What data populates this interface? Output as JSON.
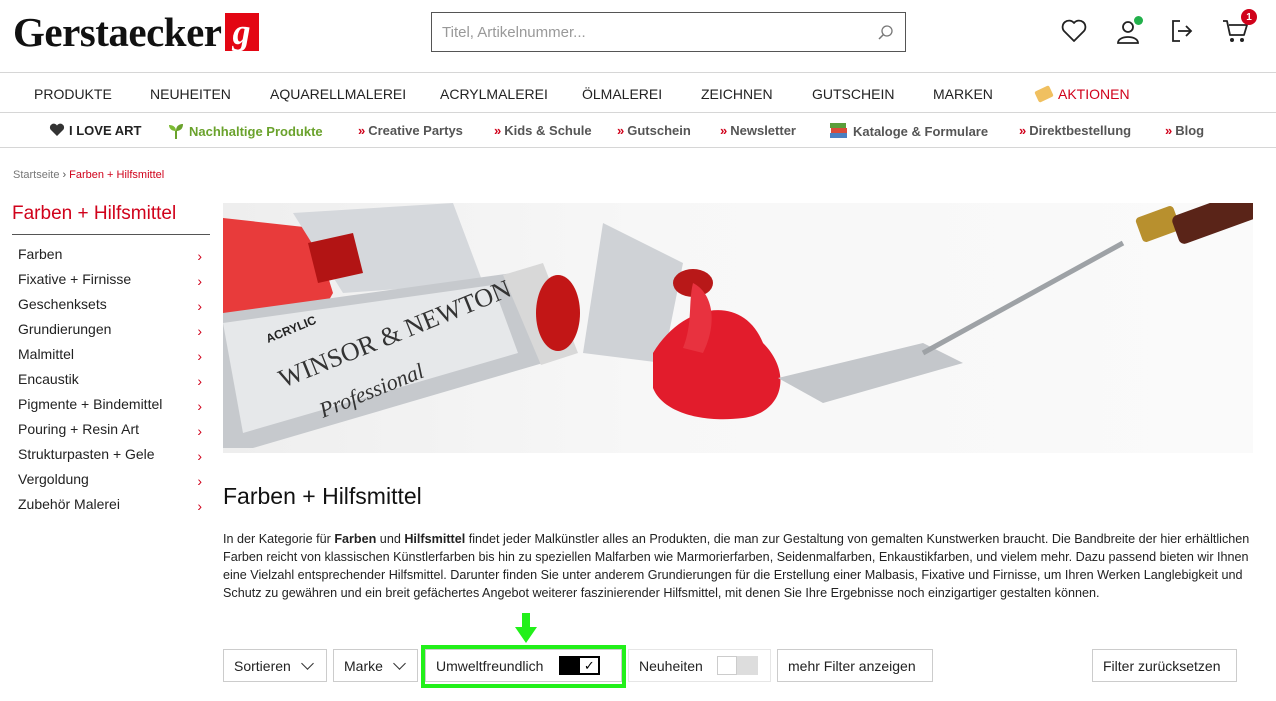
{
  "header": {
    "logo_text": "Gerstaecker",
    "logo_mark": "g",
    "search_placeholder": "Titel, Artikelnummer...",
    "cart_count": "1"
  },
  "main_nav": [
    {
      "label": "PRODUKTE"
    },
    {
      "label": "NEUHEITEN"
    },
    {
      "label": "AQUARELLMALEREI"
    },
    {
      "label": "ACRYLMALEREI"
    },
    {
      "label": "ÖLMALEREI"
    },
    {
      "label": "ZEICHNEN"
    },
    {
      "label": "GUTSCHEIN"
    },
    {
      "label": "MARKEN"
    },
    {
      "label": "AKTIONEN"
    }
  ],
  "sub_nav": [
    {
      "label": "I LOVE ART"
    },
    {
      "label": "Nachhaltige Produkte"
    },
    {
      "label": "Creative Partys"
    },
    {
      "label": "Kids & Schule"
    },
    {
      "label": "Gutschein"
    },
    {
      "label": "Newsletter"
    },
    {
      "label": "Kataloge & Formulare"
    },
    {
      "label": "Direktbestellung"
    },
    {
      "label": "Blog"
    }
  ],
  "breadcrumb": {
    "home": "Startseite",
    "current": "Farben + Hilfsmittel"
  },
  "sidebar": {
    "title": "Farben + Hilfsmittel",
    "items": [
      {
        "label": "Farben"
      },
      {
        "label": "Fixative + Firnisse"
      },
      {
        "label": "Geschenksets"
      },
      {
        "label": "Grundierungen"
      },
      {
        "label": "Malmittel"
      },
      {
        "label": "Encaustik"
      },
      {
        "label": "Pigmente + Bindemittel"
      },
      {
        "label": "Pouring + Resin Art"
      },
      {
        "label": "Strukturpasten + Gele"
      },
      {
        "label": "Vergoldung"
      },
      {
        "label": "Zubehör Malerei"
      }
    ]
  },
  "hero": {
    "tube_brand": "WINSOR & NEWTON",
    "tube_line": "Professional",
    "tube_type": "ACRYLIC"
  },
  "main": {
    "title": "Farben + Hilfsmittel",
    "intro": {
      "p1": "In der Kategorie für ",
      "b1": "Farben",
      "p2": " und ",
      "b2": "Hilfsmittel",
      "p3": " findet jeder Malkünstler alles an Produkten, die man zur Gestaltung von gemalten Kunstwerken braucht. Die Bandbreite der hier erhältlichen Farben reicht von klassischen Künstlerfarben bis hin zu speziellen Malfarben wie Marmorierfarben, Seidenmalfarben, Enkaustikfarben, und vielem mehr. Dazu passend bieten wir Ihnen eine Vielzahl entsprechender Hilfsmittel. Darunter finden Sie unter anderem Grundierungen für die Erstellung einer Malbasis, Fixative und Firnisse, um Ihren Werken Langlebigkeit und Schutz zu gewähren und ein breit gefächertes Angebot weiterer faszinierender Hilfsmittel, mit denen Sie Ihre Ergebnisse noch einzigartiger gestalten können."
    }
  },
  "filters": {
    "sort_label": "Sortieren",
    "brand_label": "Marke",
    "eco_label": "Umweltfreundlich",
    "eco_checkmark": "✓",
    "new_label": "Neuheiten",
    "more_label": "mehr Filter anzeigen",
    "reset_label": "Filter zurücksetzen"
  },
  "colors": {
    "accent_red": "#d0021b",
    "green_link": "#6aa22c",
    "highlight_green": "#22f01a"
  }
}
